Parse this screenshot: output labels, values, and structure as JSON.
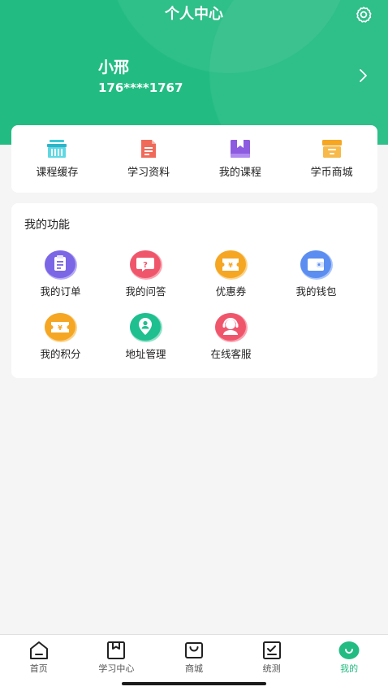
{
  "header": {
    "title": "个人中心",
    "bg_color": "#22bc82",
    "settings_icon": "gear-icon"
  },
  "profile": {
    "name": "小邢",
    "phone": "176****1767",
    "arrow_icon": "chevron-right-icon"
  },
  "quick_actions": [
    {
      "label": "课程缓存",
      "icon": "download-cache-icon",
      "color": "#3cc9d6"
    },
    {
      "label": "学习资料",
      "icon": "document-icon",
      "color": "#f06a5a"
    },
    {
      "label": "我的课程",
      "icon": "bookmark-book-icon",
      "color": "#8c5be0"
    },
    {
      "label": "学币商城",
      "icon": "shop-box-icon",
      "color": "#f5a623"
    }
  ],
  "functions": {
    "title": "我的功能",
    "items": [
      {
        "label": "我的订单",
        "icon": "order-list-icon",
        "color": "#7b66e6"
      },
      {
        "label": "我的问答",
        "icon": "question-icon",
        "color": "#f0566b"
      },
      {
        "label": "优惠券",
        "icon": "coupon-icon",
        "color": "#f5a623"
      },
      {
        "label": "我的钱包",
        "icon": "wallet-icon",
        "color": "#5b8ef0"
      },
      {
        "label": "我的积分",
        "icon": "points-ticket-icon",
        "color": "#f5a623"
      },
      {
        "label": "地址管理",
        "icon": "location-pin-icon",
        "color": "#1fbf8f"
      },
      {
        "label": "在线客服",
        "icon": "customer-service-icon",
        "color": "#f0566b"
      }
    ]
  },
  "tabbar": {
    "active_color": "#22bc82",
    "tabs": [
      {
        "label": "首页",
        "icon": "home-icon",
        "active": false
      },
      {
        "label": "学习中心",
        "icon": "book-bookmark-icon",
        "active": false
      },
      {
        "label": "商城",
        "icon": "shopping-bag-icon",
        "active": false
      },
      {
        "label": "统测",
        "icon": "test-check-icon",
        "active": false
      },
      {
        "label": "我的",
        "icon": "profile-smile-icon",
        "active": true
      }
    ]
  }
}
